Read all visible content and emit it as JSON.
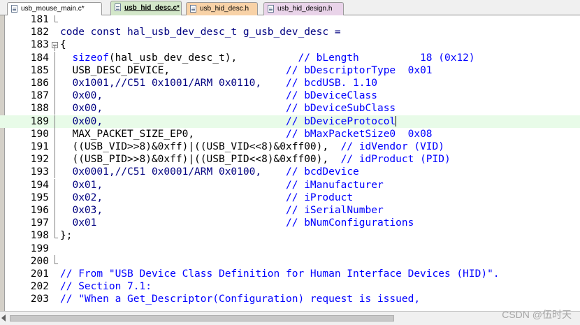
{
  "tabs": [
    {
      "label": "usb_mouse_main.c*",
      "bg": "#ffffff",
      "active": false
    },
    {
      "label": "usb_hid_desc.c*",
      "bg": "#d3e7c9",
      "active": true
    },
    {
      "label": "usb_hid_desc.h",
      "bg": "#f8d2a7",
      "active": false
    },
    {
      "label": "usb_hid_design.h",
      "bg": "#e9d3e9",
      "active": false
    }
  ],
  "current_line": 189,
  "lines": [
    {
      "n": "181",
      "fold": "end",
      "tokens": []
    },
    {
      "n": "182",
      "fold": "none",
      "tokens": [
        {
          "t": "code const hal_usb_dev_desc_t g_usb_dev_desc =",
          "c": "k"
        }
      ]
    },
    {
      "n": "183",
      "fold": "open",
      "tokens": [
        {
          "t": "{",
          "c": "p"
        }
      ]
    },
    {
      "n": "184",
      "fold": "line",
      "tokens": [
        {
          "t": "  sizeof",
          "c": "f"
        },
        {
          "t": "(hal_usb_dev_desc_t),          ",
          "c": "p"
        },
        {
          "t": "// bLength          18 (0x12)",
          "c": "c"
        }
      ]
    },
    {
      "n": "185",
      "fold": "line",
      "tokens": [
        {
          "t": "  USB_DESC_DEVICE,                   ",
          "c": "p"
        },
        {
          "t": "// bDescriptorType  0x01",
          "c": "c"
        }
      ]
    },
    {
      "n": "186",
      "fold": "line",
      "tokens": [
        {
          "t": "  0x1001,//C51 0x1001/ARM 0x0110,    ",
          "c": "n"
        },
        {
          "t": "// bcdUSB. 1.10",
          "c": "c"
        }
      ]
    },
    {
      "n": "187",
      "fold": "line",
      "tokens": [
        {
          "t": "  0x00,                              ",
          "c": "n"
        },
        {
          "t": "// bDeviceClass",
          "c": "c"
        }
      ]
    },
    {
      "n": "188",
      "fold": "line",
      "tokens": [
        {
          "t": "  0x00,                              ",
          "c": "n"
        },
        {
          "t": "// bDeviceSubClass",
          "c": "c"
        }
      ]
    },
    {
      "n": "189",
      "fold": "line",
      "tokens": [
        {
          "t": "  0x00,                              ",
          "c": "n"
        },
        {
          "t": "// bDeviceProtocol",
          "c": "c"
        }
      ]
    },
    {
      "n": "190",
      "fold": "line",
      "tokens": [
        {
          "t": "  MAX_PACKET_SIZE_EP0,               ",
          "c": "p"
        },
        {
          "t": "// bMaxPacketSize0  0x08",
          "c": "c"
        }
      ]
    },
    {
      "n": "191",
      "fold": "line",
      "tokens": [
        {
          "t": "  ((USB_VID>>8)&0xff)|((USB_VID<<8)&0xff00),  ",
          "c": "p"
        },
        {
          "t": "// idVendor (VID)",
          "c": "c"
        }
      ]
    },
    {
      "n": "192",
      "fold": "line",
      "tokens": [
        {
          "t": "  ((USB_PID>>8)&0xff)|((USB_PID<<8)&0xff00),  ",
          "c": "p"
        },
        {
          "t": "// idProduct (PID)",
          "c": "c"
        }
      ]
    },
    {
      "n": "193",
      "fold": "line",
      "tokens": [
        {
          "t": "  0x0001,//C51 0x0001/ARM 0x0100,    ",
          "c": "n"
        },
        {
          "t": "// bcdDevice",
          "c": "c"
        }
      ]
    },
    {
      "n": "194",
      "fold": "line",
      "tokens": [
        {
          "t": "  0x01,                              ",
          "c": "n"
        },
        {
          "t": "// iManufacturer",
          "c": "c"
        }
      ]
    },
    {
      "n": "195",
      "fold": "line",
      "tokens": [
        {
          "t": "  0x02,                              ",
          "c": "n"
        },
        {
          "t": "// iProduct",
          "c": "c"
        }
      ]
    },
    {
      "n": "196",
      "fold": "line",
      "tokens": [
        {
          "t": "  0x03,                              ",
          "c": "n"
        },
        {
          "t": "// iSerialNumber",
          "c": "c"
        }
      ]
    },
    {
      "n": "197",
      "fold": "line",
      "tokens": [
        {
          "t": "  0x01                               ",
          "c": "n"
        },
        {
          "t": "// bNumConfigurations",
          "c": "c"
        }
      ]
    },
    {
      "n": "198",
      "fold": "end",
      "tokens": [
        {
          "t": "};",
          "c": "p"
        }
      ]
    },
    {
      "n": "199",
      "fold": "none",
      "tokens": []
    },
    {
      "n": "200",
      "fold": "end",
      "tokens": []
    },
    {
      "n": "201",
      "fold": "none",
      "tokens": [
        {
          "t": "// From \"USB Device Class Definition for Human Interface Devices (HID)\".",
          "c": "c"
        }
      ]
    },
    {
      "n": "202",
      "fold": "none",
      "tokens": [
        {
          "t": "// Section 7.1:",
          "c": "c"
        }
      ]
    },
    {
      "n": "203",
      "fold": "none",
      "tokens": [
        {
          "t": "// \"When a Get_Descriptor(Configuration) request is issued,",
          "c": "c"
        }
      ]
    }
  ],
  "watermark": "CSDN @伍时天",
  "icons": {
    "tab_file": "file-icon",
    "fold_collapse": "fold-minus-icon",
    "scroll_left": "scroll-left-arrow-icon"
  }
}
